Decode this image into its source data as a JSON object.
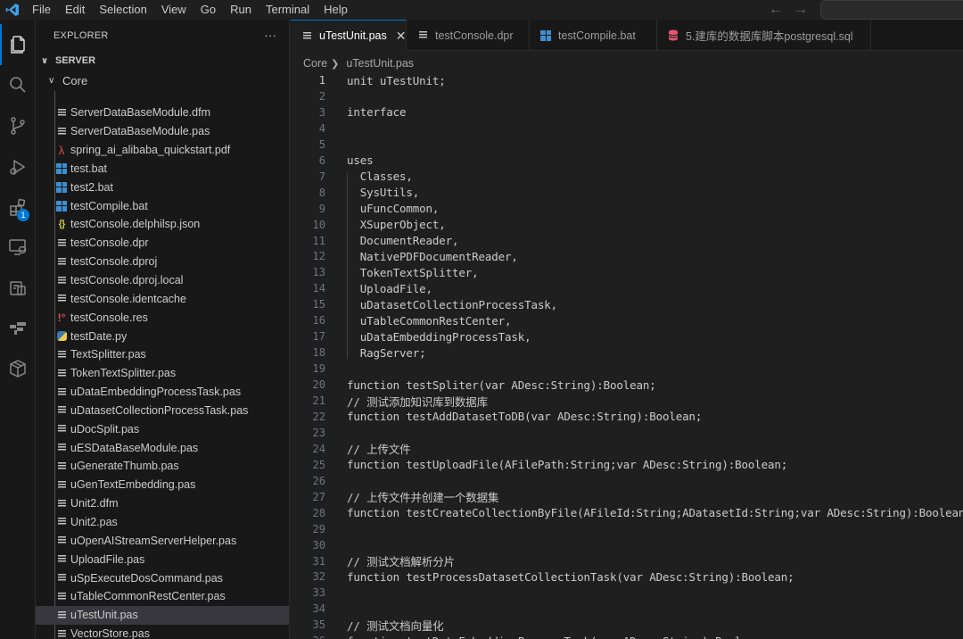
{
  "menu": [
    "File",
    "Edit",
    "Selection",
    "View",
    "Go",
    "Run",
    "Terminal",
    "Help"
  ],
  "colors": {
    "accent": "#0078d4",
    "background": "#1f1f1f",
    "sidebar": "#181818",
    "selection": "#37373d"
  },
  "activity_bar": {
    "items": [
      "explorer-icon",
      "search-icon",
      "source-control-icon",
      "run-debug-icon",
      "extensions-icon",
      "remote-explorer-icon",
      "containers-icon",
      "timeline-icon",
      "package-icon"
    ],
    "extensions_badge": "1"
  },
  "explorer": {
    "title": "EXPLORER",
    "more": "···",
    "root": "SERVER",
    "folder": "Core",
    "files": [
      {
        "name": "ServerDataBaseModule.dfm",
        "icon": "lines"
      },
      {
        "name": "ServerDataBaseModule.pas",
        "icon": "lines"
      },
      {
        "name": "spring_ai_alibaba_quickstart.pdf",
        "icon": "pdf"
      },
      {
        "name": "test.bat",
        "icon": "bat"
      },
      {
        "name": "test2.bat",
        "icon": "bat"
      },
      {
        "name": "testCompile.bat",
        "icon": "bat"
      },
      {
        "name": "testConsole.delphilsp.json",
        "icon": "json"
      },
      {
        "name": "testConsole.dpr",
        "icon": "lines"
      },
      {
        "name": "testConsole.dproj",
        "icon": "lines"
      },
      {
        "name": "testConsole.dproj.local",
        "icon": "lines"
      },
      {
        "name": "testConsole.identcache",
        "icon": "lines"
      },
      {
        "name": "testConsole.res",
        "icon": "res"
      },
      {
        "name": "testDate.py",
        "icon": "py"
      },
      {
        "name": "TextSplitter.pas",
        "icon": "lines"
      },
      {
        "name": "TokenTextSplitter.pas",
        "icon": "lines"
      },
      {
        "name": "uDataEmbeddingProcessTask.pas",
        "icon": "lines"
      },
      {
        "name": "uDatasetCollectionProcessTask.pas",
        "icon": "lines"
      },
      {
        "name": "uDocSplit.pas",
        "icon": "lines"
      },
      {
        "name": "uESDataBaseModule.pas",
        "icon": "lines"
      },
      {
        "name": "uGenerateThumb.pas",
        "icon": "lines"
      },
      {
        "name": "uGenTextEmbedding.pas",
        "icon": "lines"
      },
      {
        "name": "Unit2.dfm",
        "icon": "lines"
      },
      {
        "name": "Unit2.pas",
        "icon": "lines"
      },
      {
        "name": "uOpenAIStreamServerHelper.pas",
        "icon": "lines"
      },
      {
        "name": "UploadFile.pas",
        "icon": "lines"
      },
      {
        "name": "uSpExecuteDosCommand.pas",
        "icon": "lines"
      },
      {
        "name": "uTableCommonRestCenter.pas",
        "icon": "lines"
      },
      {
        "name": "uTestUnit.pas",
        "icon": "lines",
        "selected": true
      },
      {
        "name": "VectorStore.pas",
        "icon": "lines"
      }
    ]
  },
  "tabs": [
    {
      "label": "uTestUnit.pas",
      "icon": "lines",
      "active": true
    },
    {
      "label": "testConsole.dpr",
      "icon": "lines"
    },
    {
      "label": "testCompile.bat",
      "icon": "bat"
    },
    {
      "label": "5.建库的数据库脚本postgresql.sql",
      "icon": "db"
    }
  ],
  "breadcrumb": {
    "folder": "Core",
    "file": "uTestUnit.pas"
  },
  "code_lines": [
    {
      "n": "1",
      "text": "unit uTestUnit;"
    },
    {
      "n": "2",
      "text": ""
    },
    {
      "n": "3",
      "text": "interface"
    },
    {
      "n": "4",
      "text": ""
    },
    {
      "n": "5",
      "text": ""
    },
    {
      "n": "6",
      "text": "uses"
    },
    {
      "n": "7",
      "text": "  Classes,"
    },
    {
      "n": "8",
      "text": "  SysUtils,"
    },
    {
      "n": "9",
      "text": "  uFuncCommon,"
    },
    {
      "n": "10",
      "text": "  XSuperObject,"
    },
    {
      "n": "11",
      "text": "  DocumentReader,"
    },
    {
      "n": "12",
      "text": "  NativePDFDocumentReader,"
    },
    {
      "n": "13",
      "text": "  TokenTextSplitter,"
    },
    {
      "n": "14",
      "text": "  UploadFile,"
    },
    {
      "n": "15",
      "text": "  uDatasetCollectionProcessTask,"
    },
    {
      "n": "16",
      "text": "  uTableCommonRestCenter,"
    },
    {
      "n": "17",
      "text": "  uDataEmbeddingProcessTask,"
    },
    {
      "n": "18",
      "text": "  RagServer;"
    },
    {
      "n": "19",
      "text": ""
    },
    {
      "n": "20",
      "text": "function testSpliter(var ADesc:String):Boolean;"
    },
    {
      "n": "21",
      "text": "// 测试添加知识库到数据库"
    },
    {
      "n": "22",
      "text": "function testAddDatasetToDB(var ADesc:String):Boolean;"
    },
    {
      "n": "23",
      "text": ""
    },
    {
      "n": "24",
      "text": "// 上传文件"
    },
    {
      "n": "25",
      "text": "function testUploadFile(AFilePath:String;var ADesc:String):Boolean;"
    },
    {
      "n": "26",
      "text": ""
    },
    {
      "n": "27",
      "text": "// 上传文件并创建一个数据集"
    },
    {
      "n": "28",
      "text": "function testCreateCollectionByFile(AFileId:String;ADatasetId:String;var ADesc:String):Boolean;"
    },
    {
      "n": "29",
      "text": ""
    },
    {
      "n": "30",
      "text": ""
    },
    {
      "n": "31",
      "text": "// 测试文档解析分片"
    },
    {
      "n": "32",
      "text": "function testProcessDatasetCollectionTask(var ADesc:String):Boolean;"
    },
    {
      "n": "33",
      "text": ""
    },
    {
      "n": "34",
      "text": ""
    },
    {
      "n": "35",
      "text": "// 测试文档向量化"
    },
    {
      "n": "36",
      "text": "function testDataEmbeddingProcessTask(var ADesc:String):Boolean;"
    }
  ]
}
